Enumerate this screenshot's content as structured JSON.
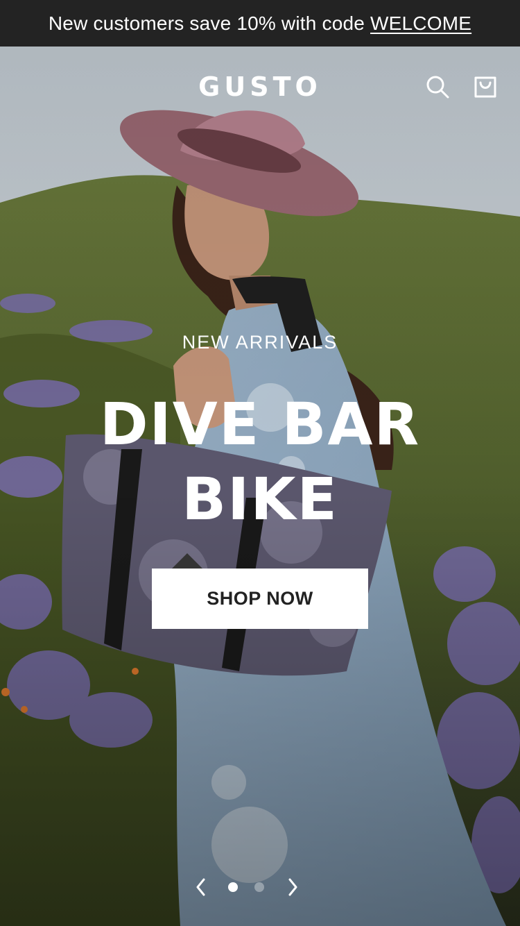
{
  "announcement": {
    "text": "New customers save 10% with code",
    "code": "WELCOME"
  },
  "header": {
    "logo": "GUSTO",
    "icons": [
      "search-icon",
      "cart-icon"
    ]
  },
  "hero": {
    "kicker": "NEW ARRIVALS",
    "headline_line1": "DIVE BAR",
    "headline_line2": "BIKE",
    "cta_label": "SHOP NOW",
    "slides": {
      "count": 2,
      "active_index": 0
    },
    "colors": {
      "sky": "#cfd6dc",
      "hill": "#6f7d3f",
      "dress": "#8fa9c0",
      "hat": "#b07f88",
      "bag": "#5d5a70"
    }
  }
}
